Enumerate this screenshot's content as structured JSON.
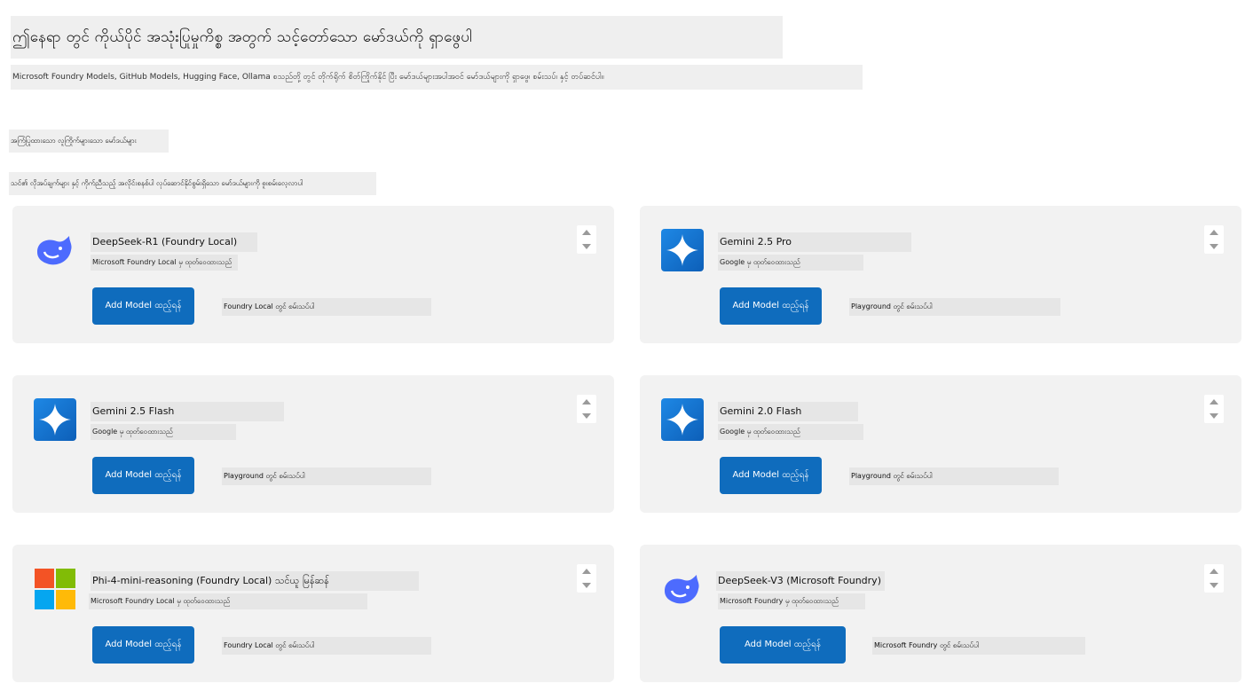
{
  "header": {
    "title": "ဤနေရာ တွင် ကိုယ်ပိုင် အသုံးပြုမှုကိစ္စ အတွက် သင့်တော်သော မော်ဒယ်ကို ရှာဖွေပါ",
    "subtitle": "Microsoft Foundry Models, GitHub Models, Hugging Face, Ollama စသည်တို့ တွင် တိုက်ရိုက် စိတ်ကြိုက်နိုင် ပြီး မော်ဒယ်များအပါအဝင် မော်ဒယ်များကို ရှာဖွေ၊ စမ်းသပ်၊ နှင့် တပ်ဆင်ပါ။"
  },
  "section": {
    "label": "အကြံပြုထားသော လူကြိုက်များသော မော်ဒယ်များ",
    "description": "သင်၏ လိုအပ်ချက်များ နှင့် ကိုက်ညီသည့် အလိုင်းစနစ်ပါ လုပ်ဆောင်နိုင်စွမ်းရှိသော မော်ဒယ်များကို စူးစမ်းလေ့လာပါ"
  },
  "models": [
    {
      "logo": "deepseek-whale-icon",
      "name": "DeepSeek-R1 (Foundry Local)",
      "meta": "Microsoft Foundry Local မှ ထုတ်ဝေထားသည်",
      "add_label": "Add Model ထည့်ရန်",
      "avail": "Foundry Local တွင် စမ်းသပ်ပါ"
    },
    {
      "logo": "gemini-star-icon",
      "name": "Gemini 2.5 Pro",
      "meta": "Google မှ ထုတ်ဝေထားသည်",
      "add_label": "Add Model ထည့်ရန်",
      "avail": "Playground တွင် စမ်းသပ်ပါ"
    },
    {
      "logo": "gemini-star-icon",
      "name": "Gemini 2.5 Flash",
      "meta": "Google မှ ထုတ်ဝေထားသည်",
      "add_label": "Add Model ထည့်ရန်",
      "avail": "Playground တွင် စမ်းသပ်ပါ"
    },
    {
      "logo": "gemini-star-icon",
      "name": "Gemini 2.0 Flash",
      "meta": "Google မှ ထုတ်ဝေထားသည်",
      "add_label": "Add Model ထည့်ရန်",
      "avail": "Playground တွင် စမ်းသပ်ပါ"
    },
    {
      "logo": "microsoft-four-squares-icon",
      "name": "Phi-4-mini-reasoning (Foundry Local) သင်ယူ မြန်ဆန်",
      "meta": "Microsoft Foundry Local မှ ထုတ်ဝေထားသည်",
      "add_label": "Add Model ထည့်ရန်",
      "avail": "Foundry Local တွင် စမ်းသပ်ပါ"
    },
    {
      "logo": "deepseek-whale-icon",
      "name": "DeepSeek-V3 (Microsoft Foundry)",
      "meta": "Microsoft Foundry မှ ထုတ်ဝေထားသည်",
      "add_label": "Add Model ထည့်ရန်",
      "avail": "Microsoft Foundry တွင် စမ်းသပ်ပါ"
    }
  ],
  "colors": {
    "accent": "#0f6cbd",
    "card_bg": "#f2f2f2",
    "deepseek": "#4d6bfe",
    "gemini": "#1e88e5"
  }
}
